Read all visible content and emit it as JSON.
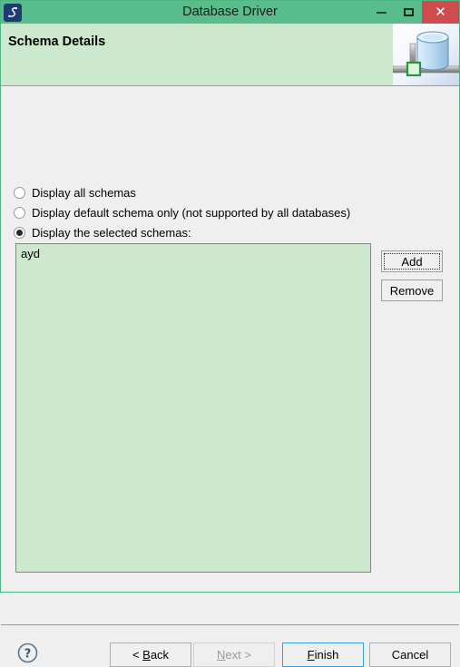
{
  "window": {
    "title": "Database Driver",
    "app_icon": "driver-app-icon",
    "controls": {
      "minimize": "minimize-icon",
      "maximize": "maximize-icon",
      "close": "close-icon",
      "close_glyph": "✕"
    },
    "colors": {
      "titlebar": "#58bc8b",
      "close_button": "#cf4c4c",
      "header_band": "#cde9cd",
      "body": "#efefef",
      "list_background": "#cde9cd",
      "default_button_border": "#3c9ade"
    }
  },
  "header": {
    "title": "Schema Details",
    "icon": "database-cylinder-icon"
  },
  "options": {
    "radios": [
      {
        "label": "Display all schemas",
        "checked": false
      },
      {
        "label": "Display default schema only (not supported by all databases)",
        "checked": false
      },
      {
        "label": "Display the selected schemas:",
        "checked": true
      }
    ]
  },
  "schema_list": {
    "items": [
      "ayd"
    ],
    "selected": null
  },
  "side_buttons": {
    "add": "Add",
    "remove": "Remove",
    "focused": "add"
  },
  "footer": {
    "help": "help-icon",
    "buttons": [
      {
        "name": "back",
        "label": "< Back",
        "mnemonic": "B",
        "disabled": false,
        "default": false
      },
      {
        "name": "next",
        "label": "Next >",
        "mnemonic": "N",
        "disabled": true,
        "default": false
      },
      {
        "name": "finish",
        "label": "Finish",
        "mnemonic": "F",
        "disabled": false,
        "default": true
      },
      {
        "name": "cancel",
        "label": "Cancel",
        "mnemonic": "",
        "disabled": false,
        "default": false
      }
    ]
  }
}
